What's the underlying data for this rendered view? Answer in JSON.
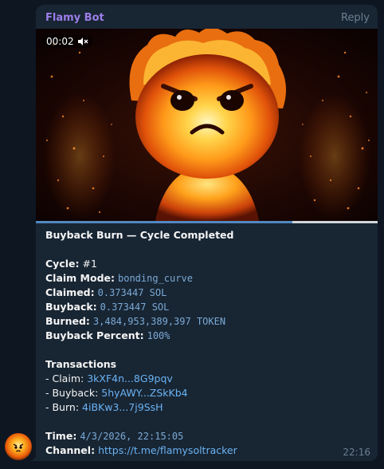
{
  "message": {
    "sender": "Flamy Bot",
    "reply_label": "Reply",
    "video_time": "00:02",
    "video_progress_fraction": 0.75,
    "title": "Buyback Burn — Cycle Completed",
    "cycle_label": "Cycle:",
    "cycle_value": "#1",
    "claim_mode_label": "Claim Mode:",
    "claim_mode_value": "bonding_curve",
    "claimed_label": "Claimed:",
    "claimed_value": "0.373447 SOL",
    "buyback_label": "Buyback:",
    "buyback_value": "0.373447 SOL",
    "burned_label": "Burned:",
    "burned_value": "3,484,953,389,397 TOKEN",
    "buyback_percent_label": "Buyback Percent:",
    "buyback_percent_value": "100%",
    "transactions_heading": "Transactions",
    "tx_claim_label": "- Claim: ",
    "tx_claim_link": "3kXF4n...8G9pqv",
    "tx_buyback_label": "- Buyback: ",
    "tx_buyback_link": "5hyAWY...ZSkKb4",
    "tx_burn_label": "- Burn: ",
    "tx_burn_link": "4iBKw3...7j9SsH",
    "time_label": "Time:",
    "time_value": "4/3/2026, 22:15:05",
    "channel_label": "Channel:",
    "channel_link": "https://t.me/flamysoltracker",
    "sent_time": "22:16"
  },
  "icons": {
    "mute": "speaker-muted-icon",
    "avatar": "flame-mascot-avatar"
  },
  "colors": {
    "background": "#0e1621",
    "bubble": "#182533",
    "sender": "#9c7ee8",
    "link": "#6ab3f3",
    "code": "#7aaad6",
    "progress": "#5288c1"
  }
}
